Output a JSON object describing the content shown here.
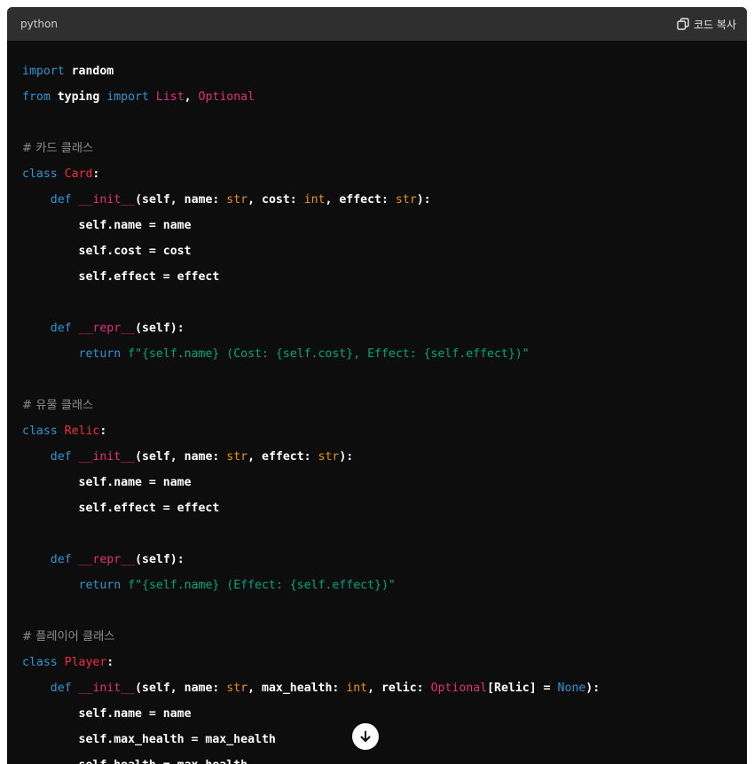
{
  "header": {
    "language": "python",
    "copy_label": "코드 복사"
  },
  "icons": {
    "copy": "copy-icon",
    "scroll": "arrow-down-icon"
  },
  "colors": {
    "background": "#0d0d0d",
    "header": "#2f2f2f",
    "keyword": "#2e95d3",
    "class_name": "#f22c3d",
    "function_name": "#df3079",
    "builtin": "#e9950c",
    "string": "#00a67d",
    "comment": "#8c8c8c",
    "text": "#ffffff"
  },
  "code_lines": [
    [
      {
        "t": "import",
        "c": "kw"
      },
      {
        "t": " random"
      }
    ],
    [
      {
        "t": "from",
        "c": "kw"
      },
      {
        "t": " typing "
      },
      {
        "t": "import",
        "c": "kw"
      },
      {
        "t": " "
      },
      {
        "t": "List",
        "c": "fn"
      },
      {
        "t": ", "
      },
      {
        "t": "Optional",
        "c": "fn"
      }
    ],
    [],
    [
      {
        "t": "# 카드 클래스",
        "c": "cmt"
      }
    ],
    [
      {
        "t": "class",
        "c": "kw"
      },
      {
        "t": " "
      },
      {
        "t": "Card",
        "c": "cls"
      },
      {
        "t": ":"
      }
    ],
    [
      {
        "t": "    "
      },
      {
        "t": "def",
        "c": "kw"
      },
      {
        "t": " "
      },
      {
        "t": "__init__",
        "c": "fn"
      },
      {
        "t": "(self, name: "
      },
      {
        "t": "str",
        "c": "bi"
      },
      {
        "t": ", cost: "
      },
      {
        "t": "int",
        "c": "bi"
      },
      {
        "t": ", effect: "
      },
      {
        "t": "str",
        "c": "bi"
      },
      {
        "t": "):"
      }
    ],
    [
      {
        "t": "        self.name = name"
      }
    ],
    [
      {
        "t": "        self.cost = cost"
      }
    ],
    [
      {
        "t": "        self.effect = effect"
      }
    ],
    [],
    [
      {
        "t": "    "
      },
      {
        "t": "def",
        "c": "kw"
      },
      {
        "t": " "
      },
      {
        "t": "__repr__",
        "c": "fn"
      },
      {
        "t": "(self):"
      }
    ],
    [
      {
        "t": "        "
      },
      {
        "t": "return",
        "c": "kw"
      },
      {
        "t": " "
      },
      {
        "t": "f\"{self.name} (Cost: {self.cost}, Effect: {self.effect})\"",
        "c": "str"
      }
    ],
    [],
    [
      {
        "t": "# 유물 클래스",
        "c": "cmt"
      }
    ],
    [
      {
        "t": "class",
        "c": "kw"
      },
      {
        "t": " "
      },
      {
        "t": "Relic",
        "c": "cls"
      },
      {
        "t": ":"
      }
    ],
    [
      {
        "t": "    "
      },
      {
        "t": "def",
        "c": "kw"
      },
      {
        "t": " "
      },
      {
        "t": "__init__",
        "c": "fn"
      },
      {
        "t": "(self, name: "
      },
      {
        "t": "str",
        "c": "bi"
      },
      {
        "t": ", effect: "
      },
      {
        "t": "str",
        "c": "bi"
      },
      {
        "t": "):"
      }
    ],
    [
      {
        "t": "        self.name = name"
      }
    ],
    [
      {
        "t": "        self.effect = effect"
      }
    ],
    [],
    [
      {
        "t": "    "
      },
      {
        "t": "def",
        "c": "kw"
      },
      {
        "t": " "
      },
      {
        "t": "__repr__",
        "c": "fn"
      },
      {
        "t": "(self):"
      }
    ],
    [
      {
        "t": "        "
      },
      {
        "t": "return",
        "c": "kw"
      },
      {
        "t": " "
      },
      {
        "t": "f\"{self.name} (Effect: {self.effect})\"",
        "c": "str"
      }
    ],
    [],
    [
      {
        "t": "# 플레이어 클래스",
        "c": "cmt"
      }
    ],
    [
      {
        "t": "class",
        "c": "kw"
      },
      {
        "t": " "
      },
      {
        "t": "Player",
        "c": "cls"
      },
      {
        "t": ":"
      }
    ],
    [
      {
        "t": "    "
      },
      {
        "t": "def",
        "c": "kw"
      },
      {
        "t": " "
      },
      {
        "t": "__init__",
        "c": "fn"
      },
      {
        "t": "(self, name: "
      },
      {
        "t": "str",
        "c": "bi"
      },
      {
        "t": ", max_health: "
      },
      {
        "t": "int",
        "c": "bi"
      },
      {
        "t": ", relic: "
      },
      {
        "t": "Optional",
        "c": "fn"
      },
      {
        "t": "[Relic] = "
      },
      {
        "t": "None",
        "c": "kw"
      },
      {
        "t": "):"
      }
    ],
    [
      {
        "t": "        self.name = name"
      }
    ],
    [
      {
        "t": "        self.max_health = max_health"
      }
    ],
    [
      {
        "t": "        self.health = max_health"
      }
    ]
  ]
}
